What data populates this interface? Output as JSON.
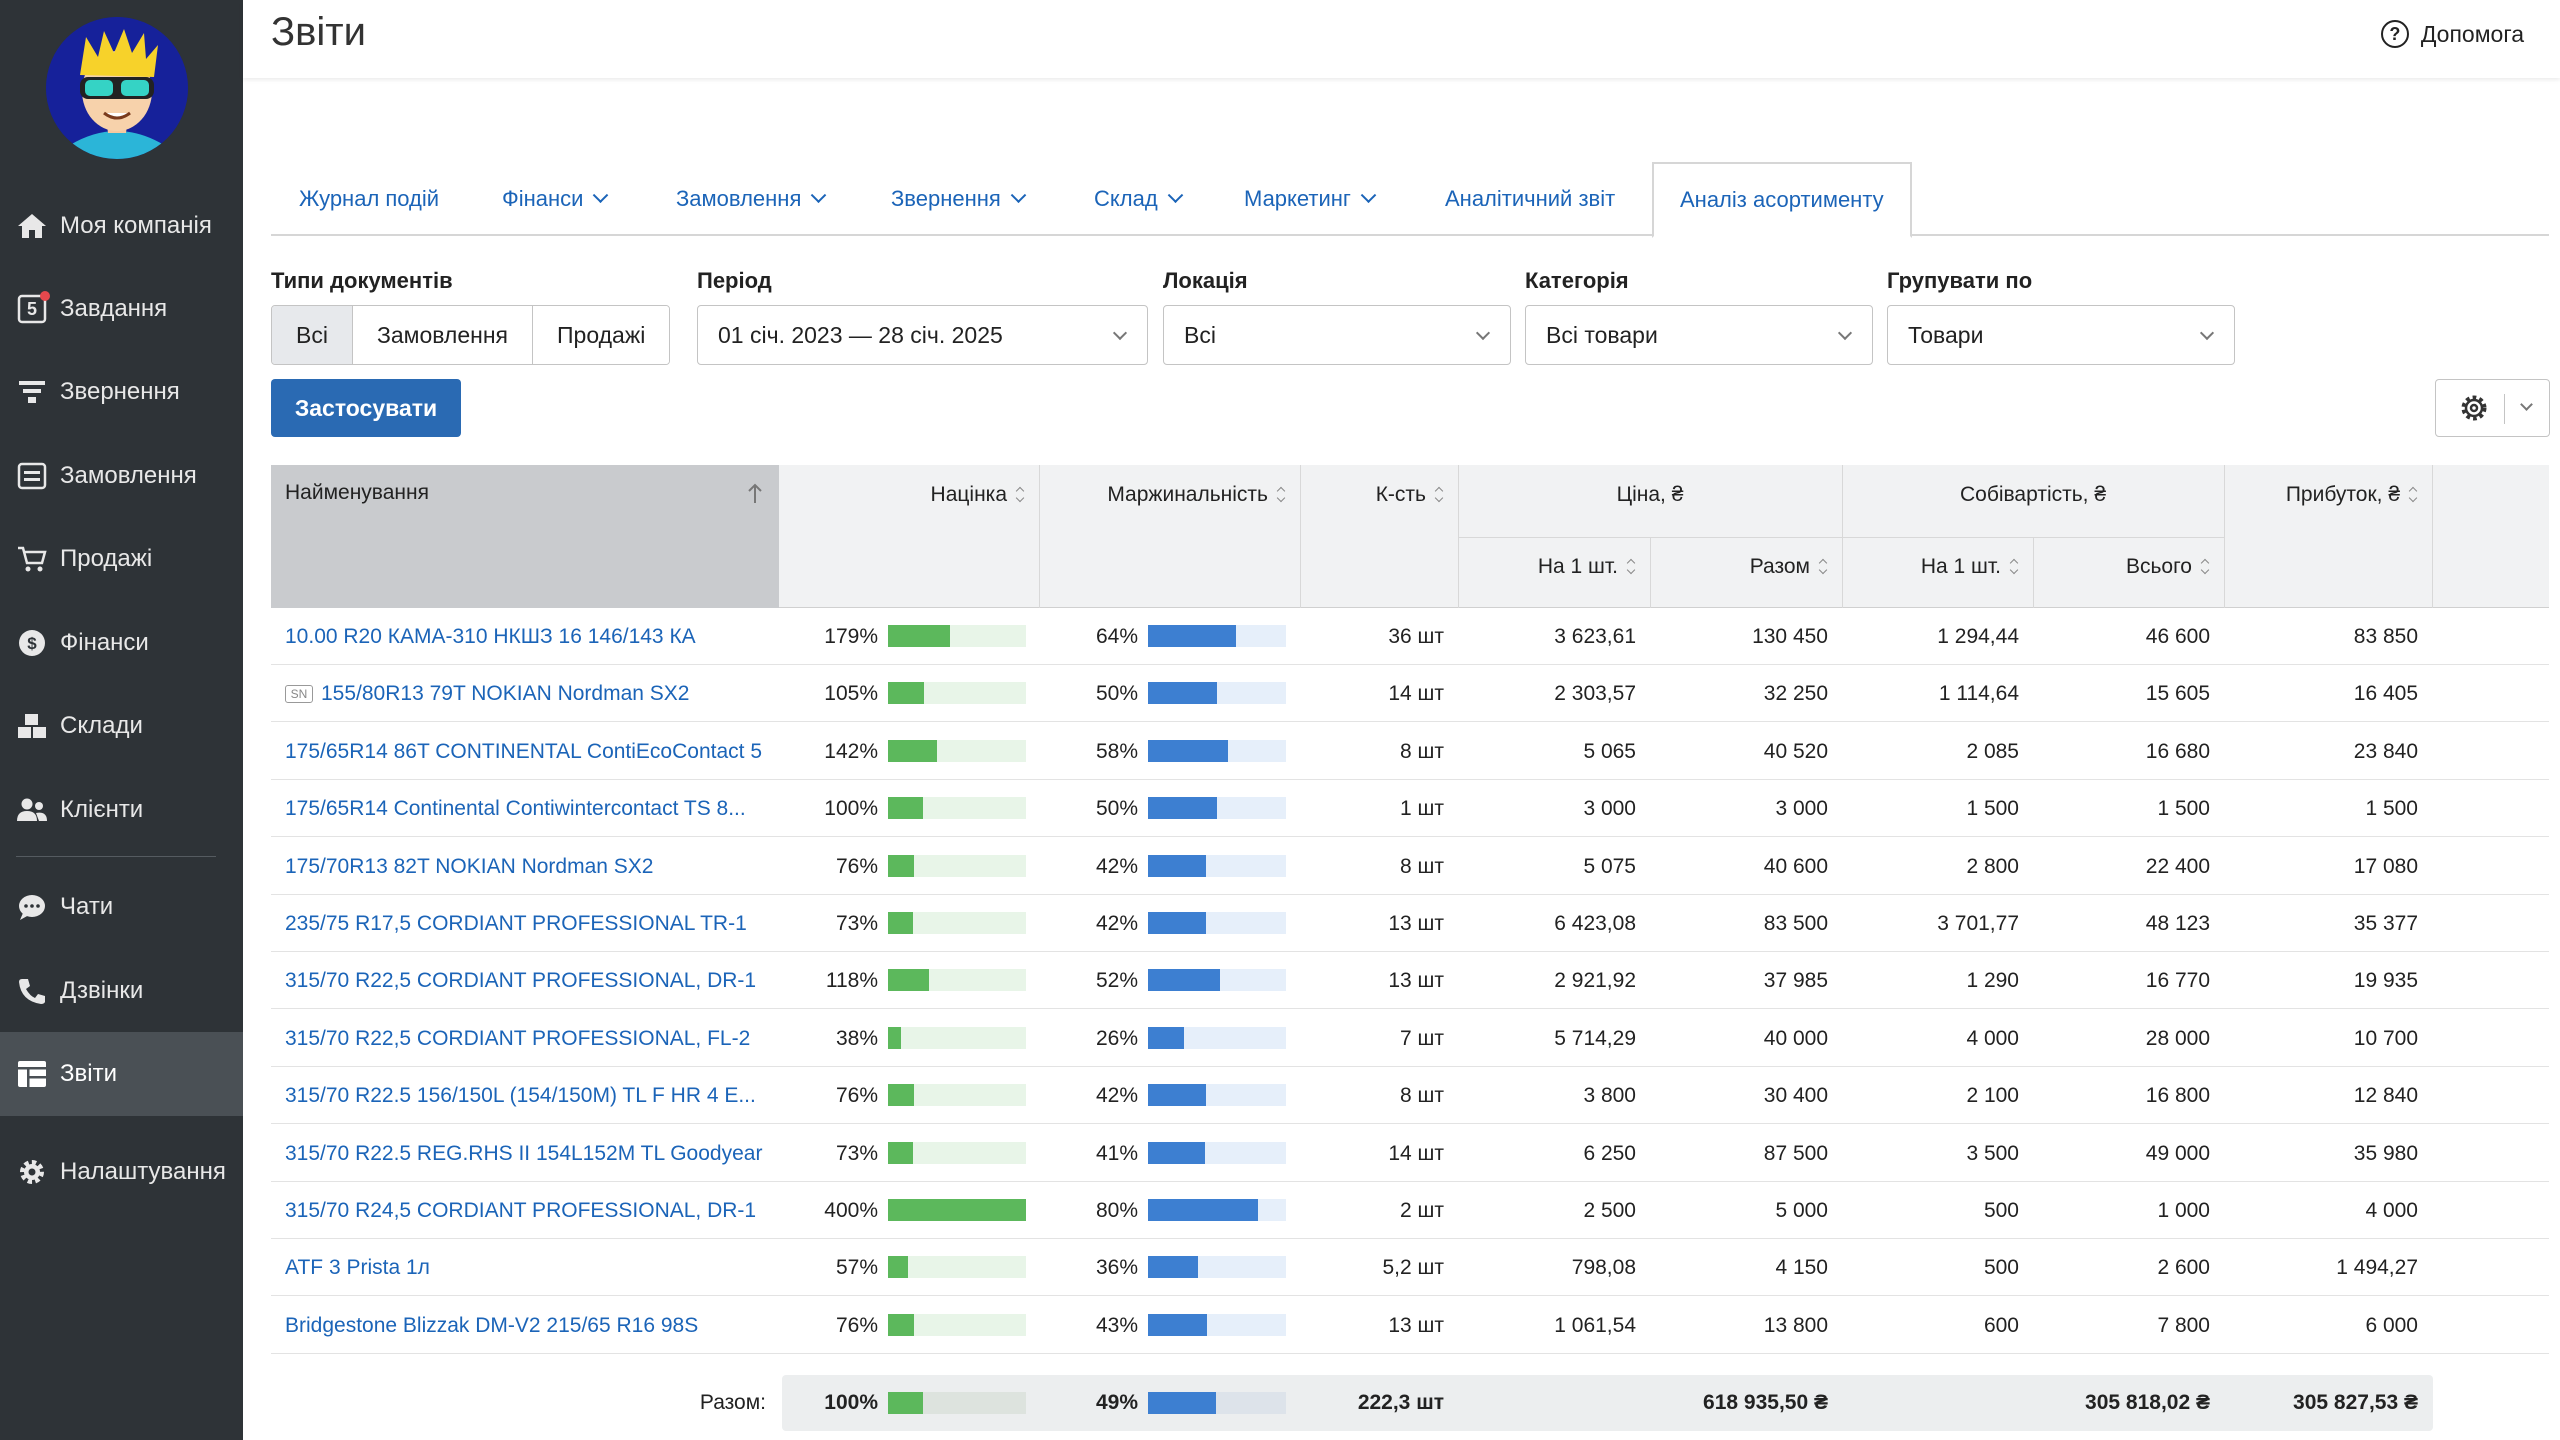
{
  "sidebar": {
    "items": [
      {
        "label": "Моя компанія",
        "icon": "home-icon"
      },
      {
        "label": "Завдання",
        "icon": "tasks-icon",
        "badge": "5"
      },
      {
        "label": "Звернення",
        "icon": "funnel-icon"
      },
      {
        "label": "Замовлення",
        "icon": "orders-icon"
      },
      {
        "label": "Продажі",
        "icon": "cart-icon"
      },
      {
        "label": "Фінанси",
        "icon": "dollar-icon"
      },
      {
        "label": "Склади",
        "icon": "boxes-icon"
      },
      {
        "label": "Клієнти",
        "icon": "users-icon"
      },
      {
        "label": "Чати",
        "icon": "chat-icon"
      },
      {
        "label": "Дзвінки",
        "icon": "phone-icon"
      },
      {
        "label": "Звіти",
        "icon": "reports-icon",
        "active": true
      },
      {
        "label": "Налаштування",
        "icon": "gear-icon"
      }
    ]
  },
  "header": {
    "title": "Звіти",
    "help": "Допомога"
  },
  "tabs": [
    {
      "label": "Журнал подій",
      "dropdown": false
    },
    {
      "label": "Фінанси",
      "dropdown": true
    },
    {
      "label": "Замовлення",
      "dropdown": true
    },
    {
      "label": "Звернення",
      "dropdown": true
    },
    {
      "label": "Склад",
      "dropdown": true
    },
    {
      "label": "Маркетинг",
      "dropdown": true
    },
    {
      "label": "Аналітичний звіт",
      "dropdown": false
    },
    {
      "label": "Аналіз асортименту",
      "dropdown": false,
      "active": true
    }
  ],
  "filters": {
    "doc_types": {
      "label": "Типи документів",
      "options": [
        "Всі",
        "Замовлення",
        "Продажі"
      ],
      "selected": "Всі"
    },
    "period": {
      "label": "Період",
      "value": "01 січ. 2023 — 28 січ. 2025"
    },
    "location": {
      "label": "Локація",
      "value": "Всі"
    },
    "category": {
      "label": "Категорія",
      "value": "Всі товари"
    },
    "group_by": {
      "label": "Групувати по",
      "value": "Товари"
    },
    "apply": "Застосувати"
  },
  "table": {
    "headers": {
      "name": "Найменування",
      "markup": "Націнка",
      "margin": "Маржинальність",
      "qty": "К-сть",
      "price": "Ціна, ₴",
      "price_unit": "На 1 шт.",
      "price_total": "Разом",
      "cost": "Собівартість, ₴",
      "cost_unit": "На 1 шт.",
      "cost_total": "Всього",
      "profit": "Прибуток, ₴"
    },
    "rows": [
      {
        "name": "10.00 R20 КАМА-310 НКШЗ 16 146/143 КА",
        "sn": false,
        "markup": "179%",
        "markup_pct": 179,
        "margin": "64%",
        "margin_pct": 64,
        "qty": "36 шт",
        "price_unit": "3 623,61",
        "price_total": "130 450",
        "cost_unit": "1 294,44",
        "cost_total": "46 600",
        "profit": "83 850"
      },
      {
        "name": "155/80R13 79T NOKIAN Nordman SX2",
        "sn": true,
        "sn_label": "SN",
        "markup": "105%",
        "markup_pct": 105,
        "margin": "50%",
        "margin_pct": 50,
        "qty": "14 шт",
        "price_unit": "2 303,57",
        "price_total": "32 250",
        "cost_unit": "1 114,64",
        "cost_total": "15 605",
        "profit": "16 405"
      },
      {
        "name": "175/65R14 86T CONTINENTAL ContiEcoContact 5",
        "sn": false,
        "markup": "142%",
        "markup_pct": 142,
        "margin": "58%",
        "margin_pct": 58,
        "qty": "8 шт",
        "price_unit": "5 065",
        "price_total": "40 520",
        "cost_unit": "2 085",
        "cost_total": "16 680",
        "profit": "23 840"
      },
      {
        "name": "175/65R14 Continental Contiwintercontact TS 8...",
        "sn": false,
        "markup": "100%",
        "markup_pct": 100,
        "margin": "50%",
        "margin_pct": 50,
        "qty": "1 шт",
        "price_unit": "3 000",
        "price_total": "3 000",
        "cost_unit": "1 500",
        "cost_total": "1 500",
        "profit": "1 500"
      },
      {
        "name": "175/70R13 82T NOKIAN Nordman SX2",
        "sn": false,
        "markup": "76%",
        "markup_pct": 76,
        "margin": "42%",
        "margin_pct": 42,
        "qty": "8 шт",
        "price_unit": "5 075",
        "price_total": "40 600",
        "cost_unit": "2 800",
        "cost_total": "22 400",
        "profit": "17 080"
      },
      {
        "name": "235/75 R17,5 CORDIANT PROFESSIONAL TR-1",
        "sn": false,
        "markup": "73%",
        "markup_pct": 73,
        "margin": "42%",
        "margin_pct": 42,
        "qty": "13 шт",
        "price_unit": "6 423,08",
        "price_total": "83 500",
        "cost_unit": "3 701,77",
        "cost_total": "48 123",
        "profit": "35 377"
      },
      {
        "name": "315/70 R22,5 CORDIANT PROFESSIONAL, DR-1",
        "sn": false,
        "markup": "118%",
        "markup_pct": 118,
        "margin": "52%",
        "margin_pct": 52,
        "qty": "13 шт",
        "price_unit": "2 921,92",
        "price_total": "37 985",
        "cost_unit": "1 290",
        "cost_total": "16 770",
        "profit": "19 935"
      },
      {
        "name": "315/70 R22,5 CORDIANT PROFESSIONAL, FL-2",
        "sn": false,
        "markup": "38%",
        "markup_pct": 38,
        "margin": "26%",
        "margin_pct": 26,
        "qty": "7 шт",
        "price_unit": "5 714,29",
        "price_total": "40 000",
        "cost_unit": "4 000",
        "cost_total": "28 000",
        "profit": "10 700"
      },
      {
        "name": "315/70 R22.5 156/150L (154/150M) TL F HR 4 E...",
        "sn": false,
        "markup": "76%",
        "markup_pct": 76,
        "margin": "42%",
        "margin_pct": 42,
        "qty": "8 шт",
        "price_unit": "3 800",
        "price_total": "30 400",
        "cost_unit": "2 100",
        "cost_total": "16 800",
        "profit": "12 840"
      },
      {
        "name": "315/70 R22.5 REG.RHS II 154L152M TL Goodyear",
        "sn": false,
        "markup": "73%",
        "markup_pct": 73,
        "margin": "41%",
        "margin_pct": 41,
        "qty": "14 шт",
        "price_unit": "6 250",
        "price_total": "87 500",
        "cost_unit": "3 500",
        "cost_total": "49 000",
        "profit": "35 980"
      },
      {
        "name": "315/70 R24,5 CORDIANT PROFESSIONAL, DR-1",
        "sn": false,
        "markup": "400%",
        "markup_pct": 400,
        "margin": "80%",
        "margin_pct": 80,
        "qty": "2 шт",
        "price_unit": "2 500",
        "price_total": "5 000",
        "cost_unit": "500",
        "cost_total": "1 000",
        "profit": "4 000"
      },
      {
        "name": "ATF 3 Prista 1л",
        "sn": false,
        "markup": "57%",
        "markup_pct": 57,
        "margin": "36%",
        "margin_pct": 36,
        "qty": "5,2 шт",
        "price_unit": "798,08",
        "price_total": "4 150",
        "cost_unit": "500",
        "cost_total": "2 600",
        "profit": "1 494,27"
      },
      {
        "name": "Bridgestone Blizzak DM-V2 215/65 R16 98S",
        "sn": false,
        "markup": "76%",
        "markup_pct": 76,
        "margin": "43%",
        "margin_pct": 43,
        "qty": "13 шт",
        "price_unit": "1 061,54",
        "price_total": "13 800",
        "cost_unit": "600",
        "cost_total": "7 800",
        "profit": "6 000"
      }
    ],
    "totals": {
      "label": "Разом:",
      "markup": "100%",
      "markup_pct": 100,
      "margin": "49%",
      "margin_pct": 49,
      "qty": "222,3 шт",
      "price_total": "618 935,50 ₴",
      "cost_total": "305 818,02 ₴",
      "profit": "305 827,53 ₴"
    }
  },
  "colors": {
    "sidebar_bg": "#2e3337",
    "link": "#1b64b8",
    "primary_button": "#2a6ab3",
    "markup_bar": "#5cb85c",
    "markup_bar_bg": "#e8f5e8",
    "margin_bar": "#3d7fd1",
    "margin_bar_bg": "#e6effa"
  }
}
